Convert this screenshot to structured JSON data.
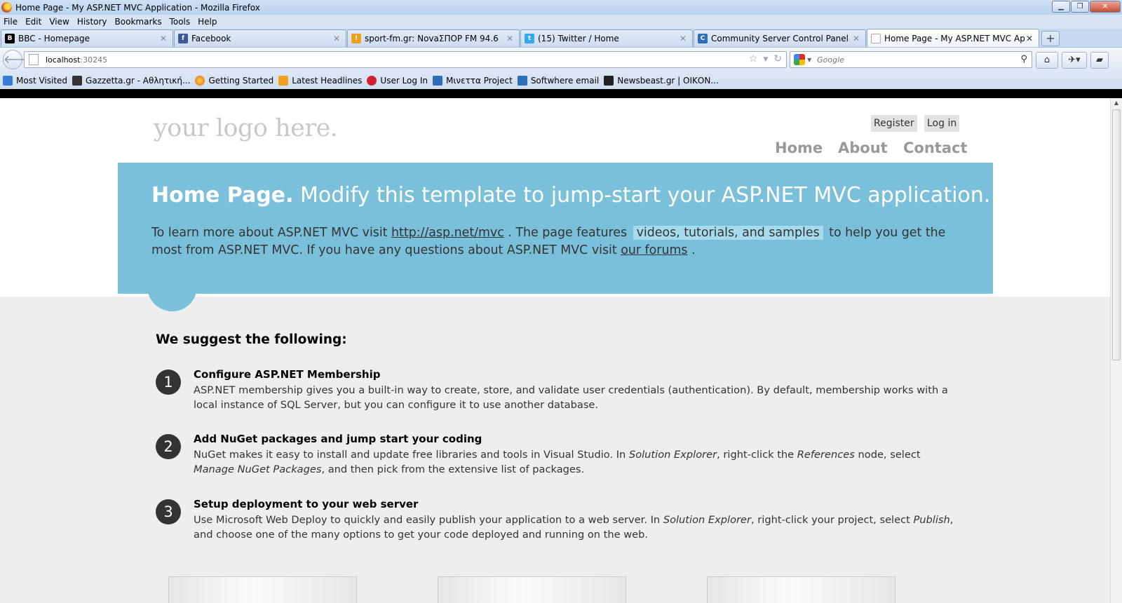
{
  "window": {
    "title": "Home Page - My ASP.NET MVC Application - Mozilla Firefox"
  },
  "menu": [
    "File",
    "Edit",
    "View",
    "History",
    "Bookmarks",
    "Tools",
    "Help"
  ],
  "tabs": [
    {
      "label": "BBC - Homepage",
      "icon": "bbc-icon",
      "color": "#000000"
    },
    {
      "label": "Facebook",
      "icon": "facebook-icon",
      "color": "#3b5998"
    },
    {
      "label": "sport-fm.gr: NovaΣΠΟΡ FM 94.6",
      "icon": "sport-fm-icon",
      "color": "#f0a020"
    },
    {
      "label": "(15) Twitter / Home",
      "icon": "twitter-icon",
      "color": "#33aaee"
    },
    {
      "label": "Community Server Control Panel",
      "icon": "community-server-icon",
      "color": "#2a6fb8"
    },
    {
      "label": "Home Page - My ASP.NET MVC Appl...",
      "icon": "page-icon",
      "color": "#ffffff"
    }
  ],
  "address": {
    "host": "localhost",
    "port": ":30245"
  },
  "search": {
    "placeholder": "Google"
  },
  "bookmarks": [
    {
      "label": "Most Visited",
      "icon": "most-visited-icon",
      "color": "#3a7bd5"
    },
    {
      "label": "Gazzetta.gr - Αθλητική...",
      "icon": "gazzetta-icon",
      "color": "#333333"
    },
    {
      "label": "Getting Started",
      "icon": "firefox-icon",
      "color": "#e8620c"
    },
    {
      "label": "Latest Headlines",
      "icon": "rss-icon",
      "color": "#f0a020"
    },
    {
      "label": "User Log In",
      "icon": "user-login-icon",
      "color": "#d02030"
    },
    {
      "label": "Μινεττα Project",
      "icon": "minetta-icon",
      "color": "#2a6fb8"
    },
    {
      "label": "Softwhere email",
      "icon": "softwhere-icon",
      "color": "#2a6fb8"
    },
    {
      "label": "Newsbeast.gr | ΟΙΚΟΝ...",
      "icon": "newsbeast-icon",
      "color": "#222222"
    }
  ],
  "site": {
    "logo": "your logo here.",
    "register": "Register",
    "login": "Log in",
    "nav": [
      "Home",
      "About",
      "Contact"
    ],
    "featured": {
      "title_bold": "Home Page.",
      "title_rest": " Modify this template to jump-start your ASP.NET MVC application.",
      "p1": "To learn more about ASP.NET MVC visit ",
      "link1": "http://asp.net/mvc",
      "p2": " . The page features ",
      "highlight": "videos, tutorials, and samples",
      "p3": " to help you get the most from ASP.NET MVC. If you have any questions about ASP.NET MVC visit ",
      "link2": "our forums",
      "p4": " ."
    },
    "suggest_title": "We suggest the following:",
    "steps": [
      {
        "num": "1",
        "title": "Configure ASP.NET Membership",
        "text": "ASP.NET membership gives you a built-in way to create, store, and validate user credentials (authentication). By default, membership works with a local instance of SQL Server, but you can configure it to use another database."
      },
      {
        "num": "2",
        "title": "Add NuGet packages and jump start your coding",
        "t1": "NuGet makes it easy to install and update free libraries and tools in Visual Studio. In ",
        "i1": "Solution Explorer",
        "t2": ", right-click the ",
        "i2": "References",
        "t3": " node, select ",
        "i3": "Manage NuGet Packages",
        "t4": ", and then pick from the extensive list of packages."
      },
      {
        "num": "3",
        "title": "Setup deployment to your web server",
        "t1": "Use Microsoft Web Deploy to quickly and easily publish your application to a web server. In ",
        "i1": "Solution Explorer",
        "t2": ", right-click your project, select ",
        "i2": "Publish",
        "t3": ", and choose one of the many options to get your code deployed and running on the web."
      }
    ]
  }
}
